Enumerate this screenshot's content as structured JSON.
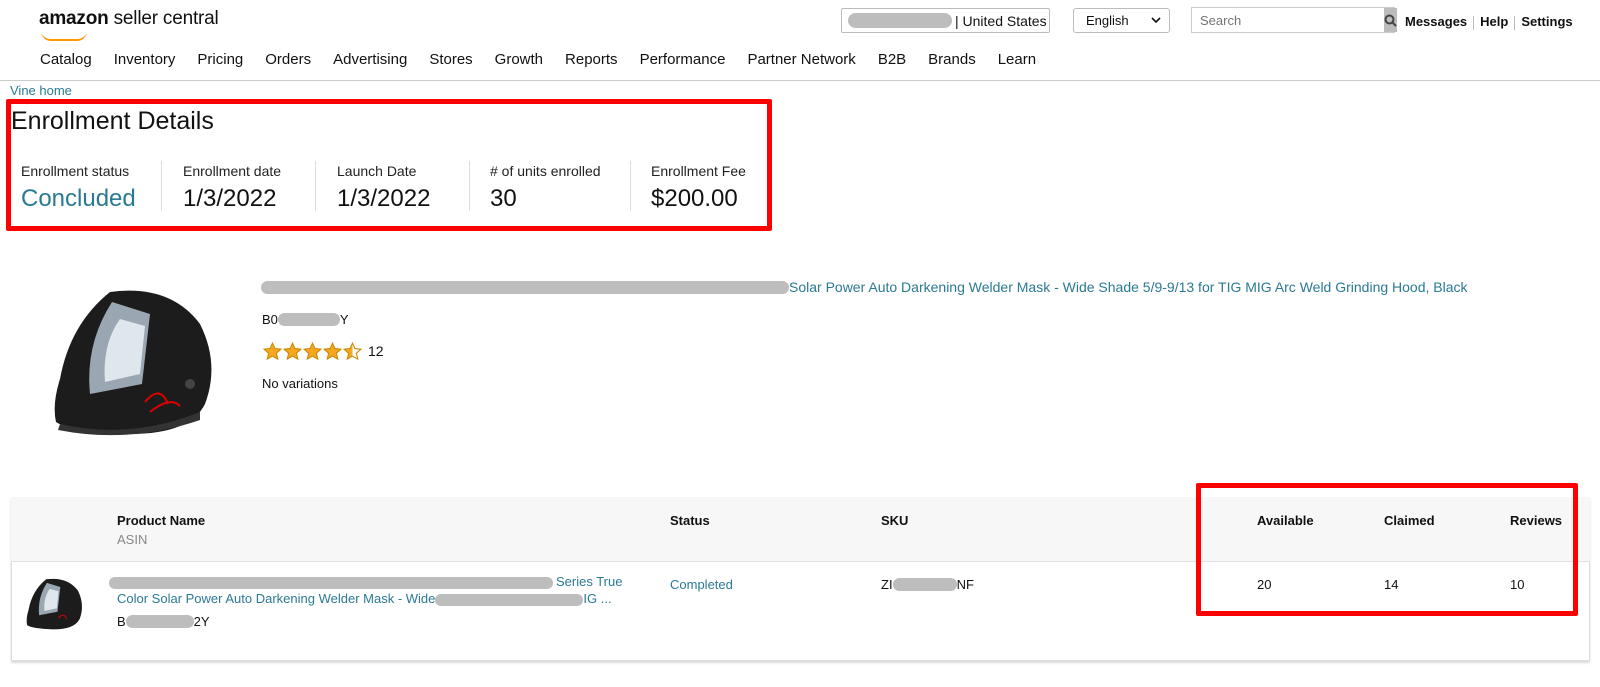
{
  "header": {
    "logo_bold": "amazon",
    "logo_rest": " seller central",
    "marketplace": "| United States",
    "language": "English",
    "search_placeholder": "Search",
    "links": [
      "Messages",
      "Help",
      "Settings"
    ]
  },
  "nav": [
    "Catalog",
    "Inventory",
    "Pricing",
    "Orders",
    "Advertising",
    "Stores",
    "Growth",
    "Reports",
    "Performance",
    "Partner Network",
    "B2B",
    "Brands",
    "Learn"
  ],
  "breadcrumb": "Vine home",
  "enrollment": {
    "title": "Enrollment Details",
    "stats": [
      {
        "label": "Enrollment status",
        "value": "Concluded"
      },
      {
        "label": "Enrollment date",
        "value": "1/3/2022"
      },
      {
        "label": "Launch Date",
        "value": "1/3/2022"
      },
      {
        "label": "# of units enrolled",
        "value": "30"
      },
      {
        "label": "Enrollment Fee",
        "value": "$200.00"
      }
    ]
  },
  "product": {
    "title_visible": "Solar Power Auto Darkening Welder Mask - Wide Shade 5/9-9/13 for TIG MIG Arc Weld Grinding Hood, Black",
    "asin_prefix": "B0",
    "asin_suffix": "Y",
    "rating_stars": 4.5,
    "review_count": "12",
    "variations": "No variations"
  },
  "table": {
    "headers": {
      "product_name": "Product Name",
      "asin": "ASIN",
      "status": "Status",
      "sku": "SKU",
      "available": "Available",
      "claimed": "Claimed",
      "reviews": "Reviews"
    },
    "row": {
      "name_part1": "Series True",
      "name_part2": "Color Solar Power Auto Darkening Welder Mask - Wide",
      "name_part3": "IG ...",
      "asin_prefix": "B",
      "asin_suffix": "2Y",
      "status": "Completed",
      "sku_prefix": "ZI",
      "sku_suffix": "NF",
      "available": "20",
      "claimed": "14",
      "reviews": "10"
    }
  },
  "colors": {
    "link": "#2a7a93",
    "highlight": "#ff0000",
    "star": "#f5a623"
  }
}
